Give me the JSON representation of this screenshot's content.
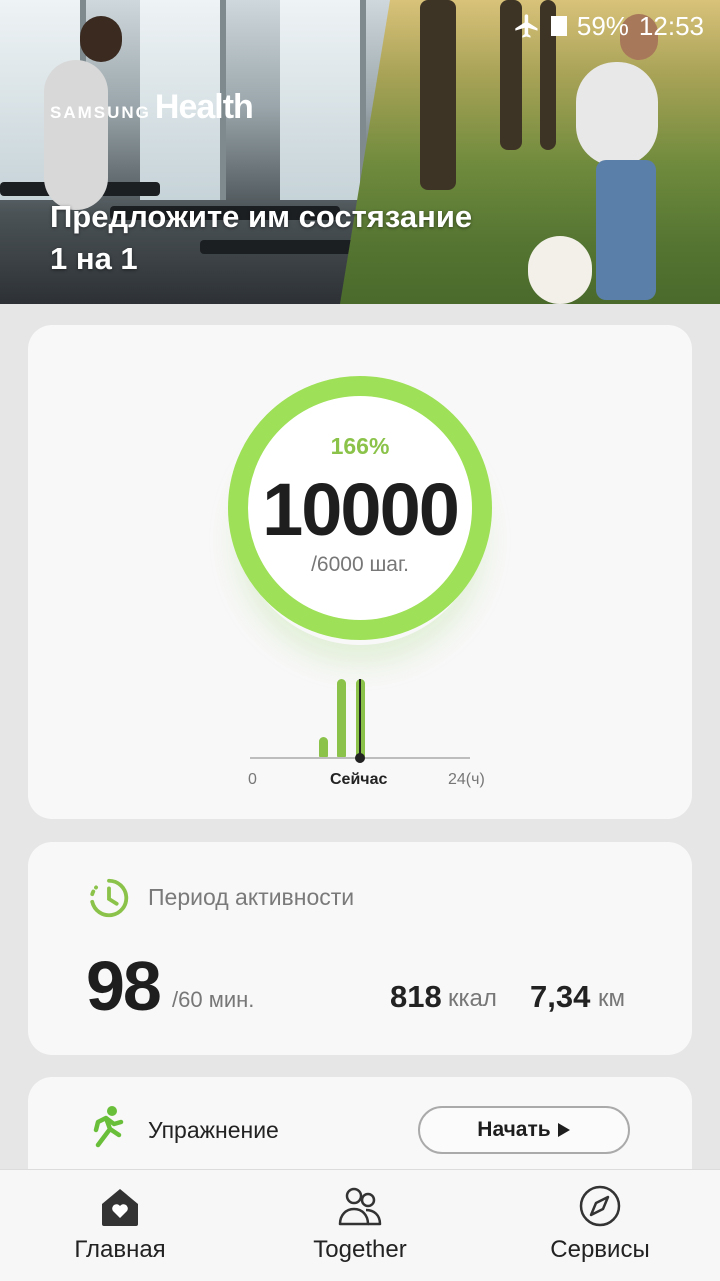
{
  "status_bar": {
    "battery": "59%",
    "time": "12:53",
    "icons": [
      "airplane-mode-icon",
      "battery-icon"
    ]
  },
  "banner": {
    "logo_samsung": "SAMSUNG",
    "logo_health": "Health",
    "title": "Предложите им состязание\n1 на 1"
  },
  "steps": {
    "percent": "166%",
    "count": "10000",
    "goal": "/6000 шаг.",
    "progress_fraction": 1.0,
    "axis_start": "0",
    "axis_now": "Сейчас",
    "axis_end": "24(ч)",
    "accent_color": "#8bc34a"
  },
  "activity": {
    "title": "Период активности",
    "minutes": "98",
    "goal": "/60 мин.",
    "kcal_value": "818",
    "kcal_unit": "ккал",
    "km_value": "7,34",
    "km_unit": "км"
  },
  "exercise": {
    "title": "Упражнение",
    "start_label": "Начать"
  },
  "nav": {
    "items": [
      {
        "label": "Главная",
        "icon": "home-heart-icon"
      },
      {
        "label": "Together",
        "icon": "people-icon"
      },
      {
        "label": "Сервисы",
        "icon": "compass-icon"
      }
    ]
  }
}
